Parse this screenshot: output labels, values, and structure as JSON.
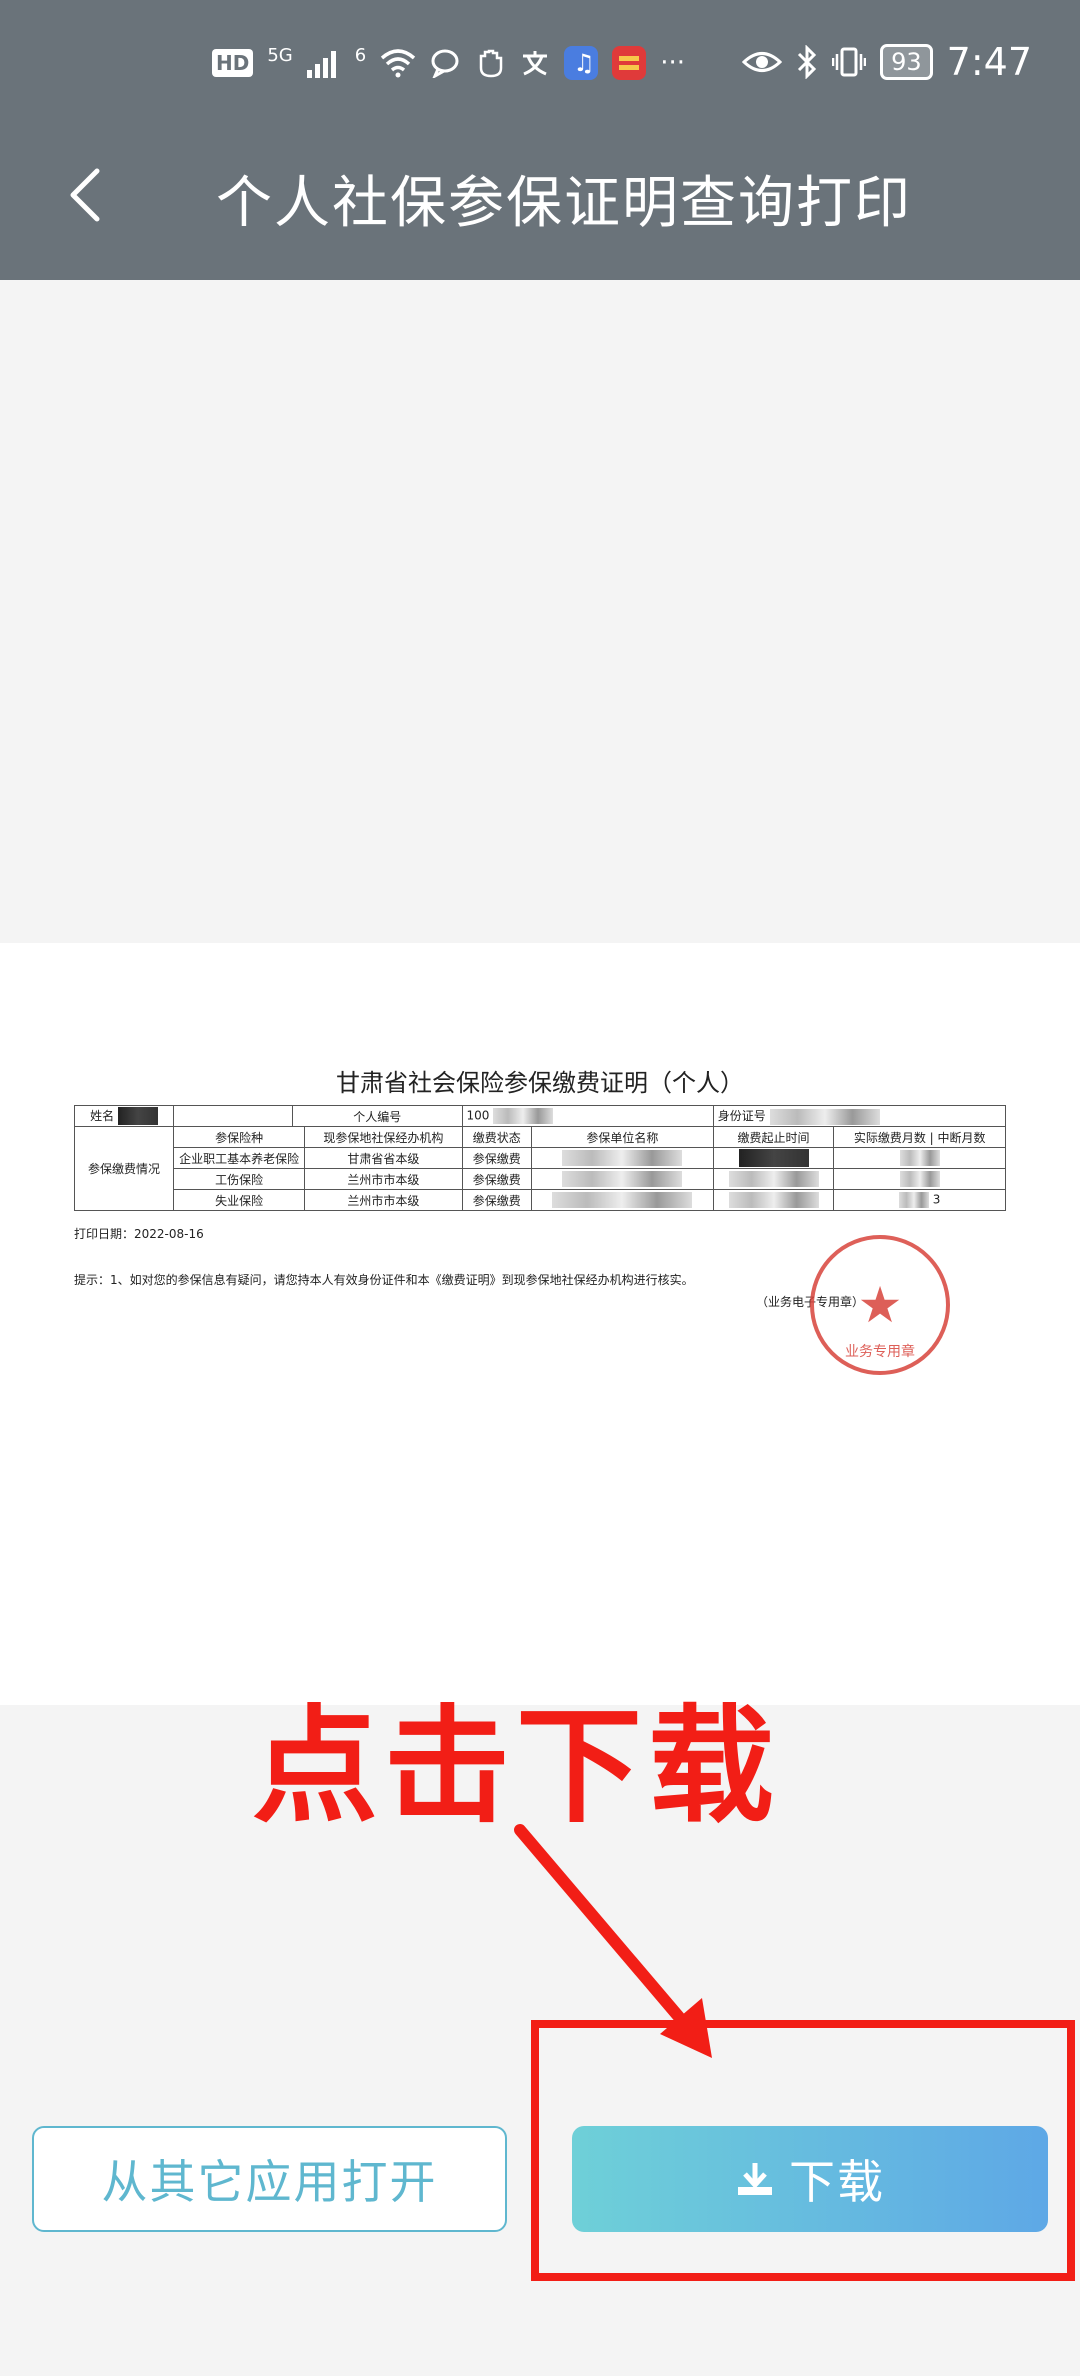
{
  "status_bar": {
    "hd_label": "HD",
    "network_label": "5G",
    "wifi_label": "6",
    "battery": "93",
    "time": "7:47",
    "more": "···"
  },
  "nav": {
    "title": "个人社保参保证明查询打印"
  },
  "document": {
    "title": "甘肃省社会保险参保缴费证明（个人）",
    "label_name": "姓名",
    "label_person_no": "个人编号",
    "person_no_partial": "100",
    "label_id": "身份证号",
    "section_label": "参保缴费情况",
    "headers": [
      "参保险种",
      "现参保地社保经办机构",
      "缴费状态",
      "参保单位名称",
      "缴费起止时间",
      "实际缴费月数",
      "中断月数"
    ],
    "rows": [
      {
        "type": "企业职工基本养老保险",
        "agency": "甘肃省省本级",
        "status": "参保缴费"
      },
      {
        "type": "工伤保险",
        "agency": "兰州市市本级",
        "status": "参保缴费"
      },
      {
        "type": "失业保险",
        "agency": "兰州市市本级",
        "status": "参保缴费",
        "interrupt": "3"
      }
    ],
    "print_date": "打印日期：2022-08-16",
    "tip": "提示：1、如对您的参保信息有疑问，请您持本人有效身份证件和本《缴费证明》到现参保地社保经办机构进行核实。",
    "seal_note": "（业务电子专用章）",
    "seal_text": "业务专用章"
  },
  "annotation": {
    "text": "点击下载",
    "color": "#f21e16"
  },
  "buttons": {
    "open_label": "从其它应用打开",
    "download_label": "下载"
  },
  "colors": {
    "header": "#6a737a",
    "accent": "#5fb7cf",
    "annotation": "#f21e16"
  }
}
